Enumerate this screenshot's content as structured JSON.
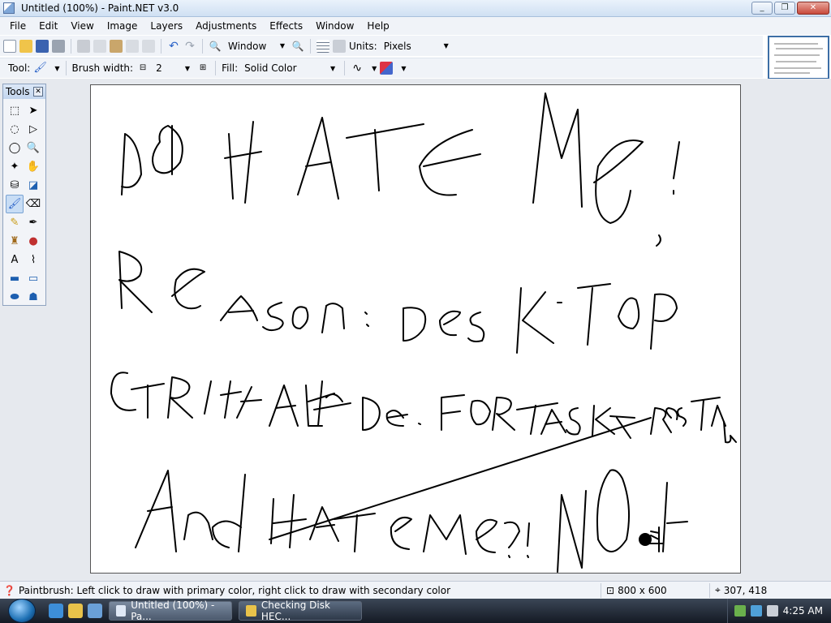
{
  "window": {
    "title": "Untitled (100%) - Paint.NET v3.0",
    "controls": [
      "_",
      "❐",
      "✕"
    ]
  },
  "menu": [
    "File",
    "Edit",
    "View",
    "Image",
    "Layers",
    "Adjustments",
    "Effects",
    "Window",
    "Help"
  ],
  "toolbar1": {
    "zoom_label": "Window",
    "units_label": "Units:",
    "units_value": "Pixels"
  },
  "toolbar2": {
    "tool_label": "Tool:",
    "brush_width_label": "Brush width:",
    "brush_width_value": "2",
    "fill_label": "Fill:",
    "fill_value": "Solid Color"
  },
  "tools_window": {
    "title": "Tools",
    "selected_tool": "paintbrush"
  },
  "canvas": {
    "lines": [
      "DON HATE ME!",
      "ReASON: DESKTOP",
      "CTRL-ALT-DE. FOR TASK REStART",
      "And HATE ME?! NOt"
    ]
  },
  "status": {
    "help_text": "Paintbrush: Left click to draw with primary color, right click to draw with secondary color",
    "image_size": "800 x 600",
    "cursor_position": "307, 418"
  },
  "taskbar": {
    "buttons": [
      {
        "label": "Untitled (100%) - Pa...",
        "active": true
      },
      {
        "label": "Checking Disk HEC...",
        "active": false
      }
    ],
    "clock": "4:25 AM"
  }
}
